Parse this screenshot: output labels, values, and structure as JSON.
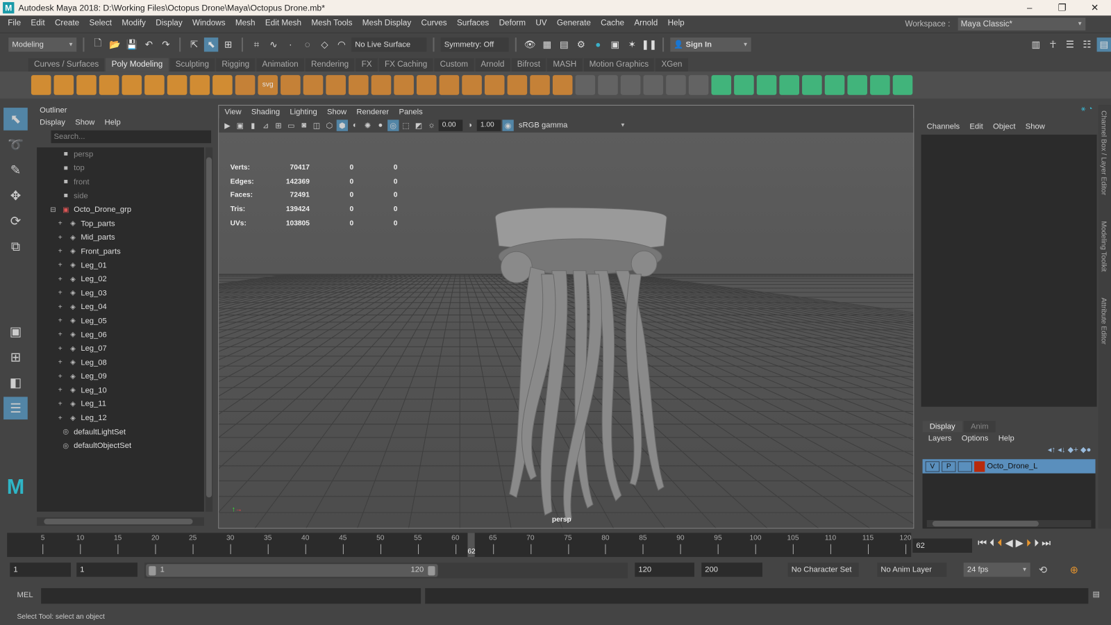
{
  "window": {
    "title": "Autodesk Maya 2018: D:\\Working Files\\Octopus Drone\\Maya\\Octopus Drone.mb*",
    "minimize": "–",
    "maximize": "❐",
    "close": "✕"
  },
  "menubar": [
    "File",
    "Edit",
    "Create",
    "Select",
    "Modify",
    "Display",
    "Windows",
    "Mesh",
    "Edit Mesh",
    "Mesh Tools",
    "Mesh Display",
    "Curves",
    "Surfaces",
    "Deform",
    "UV",
    "Generate",
    "Cache",
    "Arnold",
    "Help"
  ],
  "workspace": {
    "label": "Workspace :",
    "value": "Maya Classic*"
  },
  "statusbar": {
    "mode": "Modeling",
    "live_surface": "No Live Surface",
    "symmetry": "Symmetry: Off",
    "sign_in": "Sign In"
  },
  "shelf": {
    "tabs": [
      "Curves / Surfaces",
      "Poly Modeling",
      "Sculpting",
      "Rigging",
      "Animation",
      "Rendering",
      "FX",
      "FX Caching",
      "Custom",
      "Arnold",
      "Bifrost",
      "MASH",
      "Motion Graphics",
      "XGen"
    ],
    "active": 1,
    "svg_label": "svg",
    "colors": {
      "orange": "#e8962e",
      "green": "#3fbf7f"
    }
  },
  "outliner": {
    "title": "Outliner",
    "menu": [
      "Display",
      "Show",
      "Help"
    ],
    "search_placeholder": "Search...",
    "items": [
      {
        "label": "persp",
        "type": "camera",
        "indent": 1
      },
      {
        "label": "top",
        "type": "camera",
        "indent": 1
      },
      {
        "label": "front",
        "type": "camera",
        "indent": 1
      },
      {
        "label": "side",
        "type": "camera",
        "indent": 1
      },
      {
        "label": "Octo_Drone_grp",
        "type": "group",
        "indent": 0
      },
      {
        "label": "Top_parts",
        "type": "transform",
        "indent": 2
      },
      {
        "label": "Mid_parts",
        "type": "transform",
        "indent": 2
      },
      {
        "label": "Front_parts",
        "type": "transform",
        "indent": 2
      },
      {
        "label": "Leg_01",
        "type": "transform",
        "indent": 2
      },
      {
        "label": "Leg_02",
        "type": "transform",
        "indent": 2
      },
      {
        "label": "Leg_03",
        "type": "transform",
        "indent": 2
      },
      {
        "label": "Leg_04",
        "type": "transform",
        "indent": 2
      },
      {
        "label": "Leg_05",
        "type": "transform",
        "indent": 2
      },
      {
        "label": "Leg_06",
        "type": "transform",
        "indent": 2
      },
      {
        "label": "Leg_07",
        "type": "transform",
        "indent": 2
      },
      {
        "label": "Leg_08",
        "type": "transform",
        "indent": 2
      },
      {
        "label": "Leg_09",
        "type": "transform",
        "indent": 2
      },
      {
        "label": "Leg_10",
        "type": "transform",
        "indent": 2
      },
      {
        "label": "Leg_11",
        "type": "transform",
        "indent": 2
      },
      {
        "label": "Leg_12",
        "type": "transform",
        "indent": 2
      },
      {
        "label": "defaultLightSet",
        "type": "set",
        "indent": 1
      },
      {
        "label": "defaultObjectSet",
        "type": "set",
        "indent": 1
      }
    ]
  },
  "viewport": {
    "menu": [
      "View",
      "Shading",
      "Lighting",
      "Show",
      "Renderer",
      "Panels"
    ],
    "exposure": "0.00",
    "gamma": "1.00",
    "color_space": "sRGB gamma",
    "camera": "persp",
    "hud": [
      {
        "label": "Verts:",
        "value": "70417",
        "a": "0",
        "b": "0"
      },
      {
        "label": "Edges:",
        "value": "142369",
        "a": "0",
        "b": "0"
      },
      {
        "label": "Faces:",
        "value": "72491",
        "a": "0",
        "b": "0"
      },
      {
        "label": "Tris:",
        "value": "139424",
        "a": "0",
        "b": "0"
      },
      {
        "label": "UVs:",
        "value": "103805",
        "a": "0",
        "b": "0"
      }
    ]
  },
  "channelbox": {
    "menu": [
      "Channels",
      "Edit",
      "Object",
      "Show"
    ]
  },
  "layers": {
    "tabs": [
      "Display",
      "Anim"
    ],
    "menu": [
      "Layers",
      "Options",
      "Help"
    ],
    "layer": {
      "v": "V",
      "p": "P",
      "name": "Octo_Drone_L",
      "color": "#b82a0c"
    }
  },
  "sidetabs": [
    "Channel Box / Layer Editor",
    "Modeling Toolkit",
    "Attribute Editor"
  ],
  "timeline": {
    "ticks": [
      5,
      10,
      15,
      20,
      25,
      30,
      35,
      40,
      45,
      50,
      55,
      60,
      65,
      70,
      75,
      80,
      85,
      90,
      95,
      100,
      105,
      110,
      115,
      120
    ],
    "start": 1,
    "end": 120,
    "current": "62"
  },
  "range": {
    "start": "1",
    "anim_start": "1",
    "range_start": "1",
    "range_end": "120",
    "end": "120",
    "anim_end": "200",
    "character_set": "No Character Set",
    "anim_layer": "No Anim Layer",
    "fps": "24 fps"
  },
  "commandline": {
    "label": "MEL"
  },
  "status": "Select Tool: select an object"
}
